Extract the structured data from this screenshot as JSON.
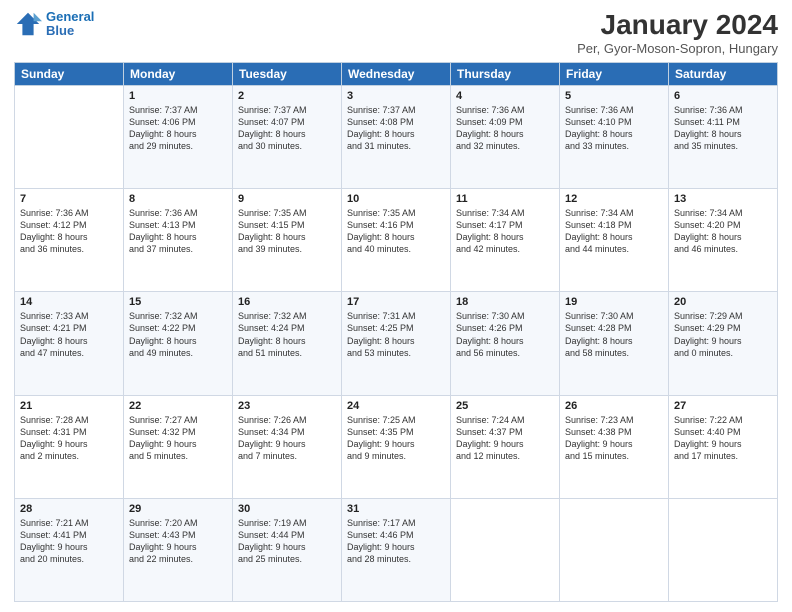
{
  "header": {
    "logo_line1": "General",
    "logo_line2": "Blue",
    "month_title": "January 2024",
    "location": "Per, Gyor-Moson-Sopron, Hungary"
  },
  "days_of_week": [
    "Sunday",
    "Monday",
    "Tuesday",
    "Wednesday",
    "Thursday",
    "Friday",
    "Saturday"
  ],
  "weeks": [
    [
      {
        "day": "",
        "text": ""
      },
      {
        "day": "1",
        "text": "Sunrise: 7:37 AM\nSunset: 4:06 PM\nDaylight: 8 hours\nand 29 minutes."
      },
      {
        "day": "2",
        "text": "Sunrise: 7:37 AM\nSunset: 4:07 PM\nDaylight: 8 hours\nand 30 minutes."
      },
      {
        "day": "3",
        "text": "Sunrise: 7:37 AM\nSunset: 4:08 PM\nDaylight: 8 hours\nand 31 minutes."
      },
      {
        "day": "4",
        "text": "Sunrise: 7:36 AM\nSunset: 4:09 PM\nDaylight: 8 hours\nand 32 minutes."
      },
      {
        "day": "5",
        "text": "Sunrise: 7:36 AM\nSunset: 4:10 PM\nDaylight: 8 hours\nand 33 minutes."
      },
      {
        "day": "6",
        "text": "Sunrise: 7:36 AM\nSunset: 4:11 PM\nDaylight: 8 hours\nand 35 minutes."
      }
    ],
    [
      {
        "day": "7",
        "text": "Sunrise: 7:36 AM\nSunset: 4:12 PM\nDaylight: 8 hours\nand 36 minutes."
      },
      {
        "day": "8",
        "text": "Sunrise: 7:36 AM\nSunset: 4:13 PM\nDaylight: 8 hours\nand 37 minutes."
      },
      {
        "day": "9",
        "text": "Sunrise: 7:35 AM\nSunset: 4:15 PM\nDaylight: 8 hours\nand 39 minutes."
      },
      {
        "day": "10",
        "text": "Sunrise: 7:35 AM\nSunset: 4:16 PM\nDaylight: 8 hours\nand 40 minutes."
      },
      {
        "day": "11",
        "text": "Sunrise: 7:34 AM\nSunset: 4:17 PM\nDaylight: 8 hours\nand 42 minutes."
      },
      {
        "day": "12",
        "text": "Sunrise: 7:34 AM\nSunset: 4:18 PM\nDaylight: 8 hours\nand 44 minutes."
      },
      {
        "day": "13",
        "text": "Sunrise: 7:34 AM\nSunset: 4:20 PM\nDaylight: 8 hours\nand 46 minutes."
      }
    ],
    [
      {
        "day": "14",
        "text": "Sunrise: 7:33 AM\nSunset: 4:21 PM\nDaylight: 8 hours\nand 47 minutes."
      },
      {
        "day": "15",
        "text": "Sunrise: 7:32 AM\nSunset: 4:22 PM\nDaylight: 8 hours\nand 49 minutes."
      },
      {
        "day": "16",
        "text": "Sunrise: 7:32 AM\nSunset: 4:24 PM\nDaylight: 8 hours\nand 51 minutes."
      },
      {
        "day": "17",
        "text": "Sunrise: 7:31 AM\nSunset: 4:25 PM\nDaylight: 8 hours\nand 53 minutes."
      },
      {
        "day": "18",
        "text": "Sunrise: 7:30 AM\nSunset: 4:26 PM\nDaylight: 8 hours\nand 56 minutes."
      },
      {
        "day": "19",
        "text": "Sunrise: 7:30 AM\nSunset: 4:28 PM\nDaylight: 8 hours\nand 58 minutes."
      },
      {
        "day": "20",
        "text": "Sunrise: 7:29 AM\nSunset: 4:29 PM\nDaylight: 9 hours\nand 0 minutes."
      }
    ],
    [
      {
        "day": "21",
        "text": "Sunrise: 7:28 AM\nSunset: 4:31 PM\nDaylight: 9 hours\nand 2 minutes."
      },
      {
        "day": "22",
        "text": "Sunrise: 7:27 AM\nSunset: 4:32 PM\nDaylight: 9 hours\nand 5 minutes."
      },
      {
        "day": "23",
        "text": "Sunrise: 7:26 AM\nSunset: 4:34 PM\nDaylight: 9 hours\nand 7 minutes."
      },
      {
        "day": "24",
        "text": "Sunrise: 7:25 AM\nSunset: 4:35 PM\nDaylight: 9 hours\nand 9 minutes."
      },
      {
        "day": "25",
        "text": "Sunrise: 7:24 AM\nSunset: 4:37 PM\nDaylight: 9 hours\nand 12 minutes."
      },
      {
        "day": "26",
        "text": "Sunrise: 7:23 AM\nSunset: 4:38 PM\nDaylight: 9 hours\nand 15 minutes."
      },
      {
        "day": "27",
        "text": "Sunrise: 7:22 AM\nSunset: 4:40 PM\nDaylight: 9 hours\nand 17 minutes."
      }
    ],
    [
      {
        "day": "28",
        "text": "Sunrise: 7:21 AM\nSunset: 4:41 PM\nDaylight: 9 hours\nand 20 minutes."
      },
      {
        "day": "29",
        "text": "Sunrise: 7:20 AM\nSunset: 4:43 PM\nDaylight: 9 hours\nand 22 minutes."
      },
      {
        "day": "30",
        "text": "Sunrise: 7:19 AM\nSunset: 4:44 PM\nDaylight: 9 hours\nand 25 minutes."
      },
      {
        "day": "31",
        "text": "Sunrise: 7:17 AM\nSunset: 4:46 PM\nDaylight: 9 hours\nand 28 minutes."
      },
      {
        "day": "",
        "text": ""
      },
      {
        "day": "",
        "text": ""
      },
      {
        "day": "",
        "text": ""
      }
    ]
  ]
}
